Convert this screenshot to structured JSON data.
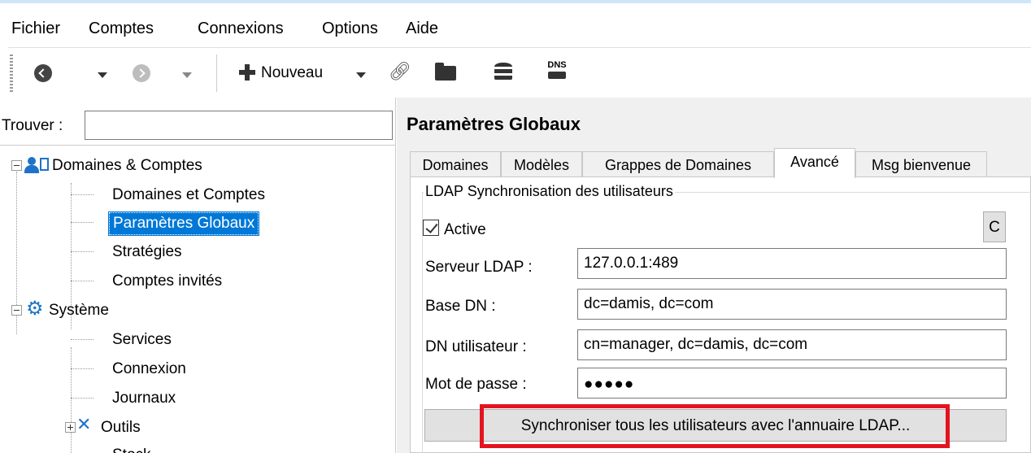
{
  "menu": [
    "Fichier",
    "Comptes",
    "Connexions",
    "Options",
    "Aide"
  ],
  "toolbar": {
    "back_icon": "back-circle-icon",
    "forward_icon": "forward-circle-icon",
    "new_label": "Nouveau",
    "dns_label": "DNS"
  },
  "search": {
    "label": "Trouver :",
    "value": ""
  },
  "tree": {
    "domains": {
      "label": "Domaines & Comptes",
      "children": [
        "Domaines et Comptes",
        "Paramètres Globaux",
        "Stratégies",
        "Comptes invités"
      ]
    },
    "system": {
      "label": "Système",
      "children": [
        "Services",
        "Connexion",
        "Journaux"
      ]
    },
    "tools": {
      "label": "Outils"
    },
    "cut": "Stock"
  },
  "page_title": "Paramètres Globaux",
  "tabs": [
    "Domaines",
    "Modèles",
    "Grappes de Domaines",
    "Avancé",
    "Msg bienvenue"
  ],
  "active_tab": "Avancé",
  "ldap": {
    "group_title": "LDAP Synchronisation des utilisateurs",
    "active_label": "Active",
    "active_checked": true,
    "side_button": "C",
    "server_label": "Serveur LDAP :",
    "server_value": "127.0.0.1:489",
    "basedn_label": "Base DN :",
    "basedn_value": "dc=damis, dc=com",
    "userdn_label": "DN utilisateur :",
    "userdn_value": "cn=manager, dc=damis, dc=com",
    "password_label": "Mot de passe :",
    "password_value": "●●●●●",
    "sync_button": "Synchroniser tous les utilisateurs avec l'annuaire LDAP..."
  },
  "colors": {
    "selection": "#0078d7",
    "highlight": "#e3141f",
    "icon_blue": "#1e73c8"
  }
}
